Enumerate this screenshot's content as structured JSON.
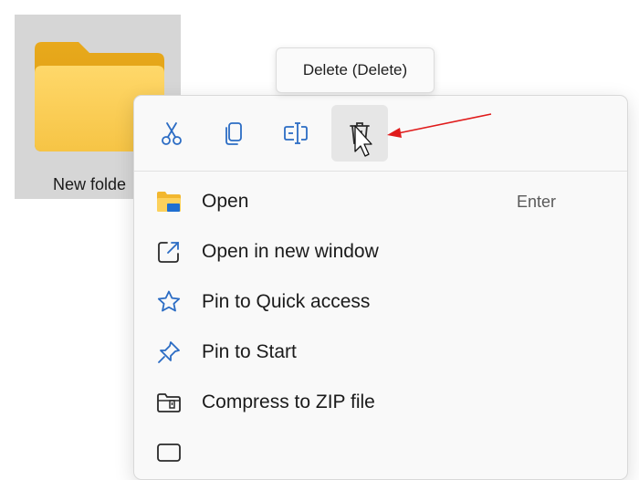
{
  "folder": {
    "label": "New folde"
  },
  "tooltip": {
    "text": "Delete (Delete)"
  },
  "toolbar": {
    "buttons": [
      {
        "icon": "cut-icon"
      },
      {
        "icon": "copy-icon"
      },
      {
        "icon": "rename-icon"
      },
      {
        "icon": "delete-icon",
        "active": true
      }
    ]
  },
  "menu": {
    "items": [
      {
        "label": "Open",
        "shortcut": "Enter",
        "icon": "folder-open-icon"
      },
      {
        "label": "Open in new window",
        "icon": "open-new-window-icon"
      },
      {
        "label": "Pin to Quick access",
        "icon": "star-icon"
      },
      {
        "label": "Pin to Start",
        "icon": "pin-icon"
      },
      {
        "label": "Compress to ZIP file",
        "icon": "zip-icon"
      }
    ]
  },
  "colors": {
    "accent": "#2b6cc4",
    "folder_yellow": "#f7c948",
    "annotation_red": "#e01b1b"
  }
}
